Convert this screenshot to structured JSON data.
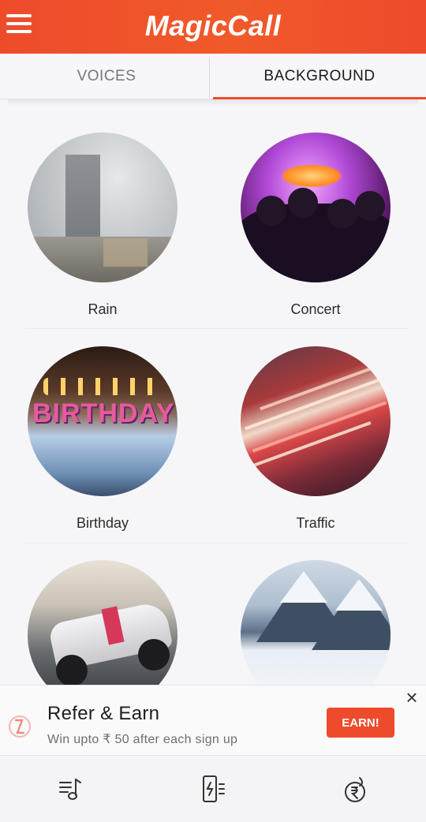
{
  "header": {
    "title": "MagicCall",
    "menu_icon": "hamburger-menu-icon"
  },
  "tabs": [
    {
      "label": "VOICES",
      "active": false
    },
    {
      "label": "BACKGROUND",
      "active": true
    }
  ],
  "colors": {
    "accent": "#ee4b2b",
    "text": "#2b2b2b",
    "muted": "#777777"
  },
  "backgrounds": [
    {
      "label": "Rain"
    },
    {
      "label": "Concert"
    },
    {
      "label": "Birthday"
    },
    {
      "label": "Traffic"
    },
    {
      "label": ""
    },
    {
      "label": ""
    }
  ],
  "birthday_image_text": "BIRTHDAY",
  "refer": {
    "title": "Refer & Earn",
    "subtitle": "Win upto ₹ 50 after each sign up",
    "button": "EARN!",
    "close": "×"
  },
  "bottom_nav": [
    {
      "icon": "music-list-icon"
    },
    {
      "icon": "phone-voice-icon"
    },
    {
      "icon": "refer-coin-icon"
    }
  ]
}
